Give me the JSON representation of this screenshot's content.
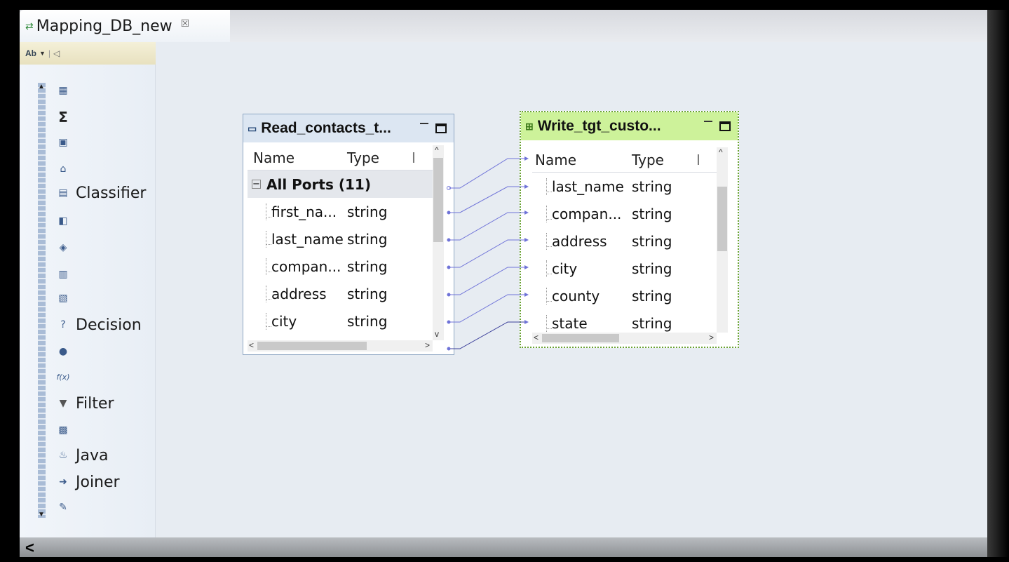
{
  "tab": {
    "title": "Mapping_DB_new",
    "close_glyph": "☒"
  },
  "palette": {
    "items": [
      {
        "icon": "expression-icon",
        "label": ""
      },
      {
        "icon": "aggregator-sigma-icon",
        "label": ""
      },
      {
        "icon": "case-converter-icon",
        "label": ""
      },
      {
        "icon": "address-validator-icon",
        "label": ""
      },
      {
        "icon": "classifier-icon",
        "label": "Classifier"
      },
      {
        "icon": "comparison-icon",
        "label": ""
      },
      {
        "icon": "consolidation-icon",
        "label": ""
      },
      {
        "icon": "data-masking-icon",
        "label": ""
      },
      {
        "icon": "data-processor-icon",
        "label": ""
      },
      {
        "icon": "decision-icon",
        "label": "Decision"
      },
      {
        "icon": "exception-icon",
        "label": ""
      },
      {
        "icon": "expression-fx-icon",
        "label": ""
      },
      {
        "icon": "filter-icon",
        "label": "Filter"
      },
      {
        "icon": "identity-match-icon",
        "label": ""
      },
      {
        "icon": "java-icon",
        "label": "Java"
      },
      {
        "icon": "joiner-icon",
        "label": "Joiner"
      },
      {
        "icon": "key-generator-icon",
        "label": ""
      }
    ],
    "fx_text": "f(x)"
  },
  "read_box": {
    "title": "Read_contacts_t...",
    "columns": {
      "name": "Name",
      "type": "Type"
    },
    "group": "All Ports (11)",
    "rows": [
      {
        "name": "first_na...",
        "type": "string"
      },
      {
        "name": "last_name",
        "type": "string"
      },
      {
        "name": "compan...",
        "type": "string"
      },
      {
        "name": "address",
        "type": "string"
      },
      {
        "name": "city",
        "type": "string"
      }
    ]
  },
  "write_box": {
    "title": "Write_tgt_custo...",
    "columns": {
      "name": "Name",
      "type": "Type"
    },
    "rows": [
      {
        "name": "last_name",
        "type": "string"
      },
      {
        "name": "compan...",
        "type": "string"
      },
      {
        "name": "address",
        "type": "string"
      },
      {
        "name": "city",
        "type": "string"
      },
      {
        "name": "county",
        "type": "string"
      },
      {
        "name": "state",
        "type": "string"
      }
    ]
  },
  "colors": {
    "canvas": "#e7ecf2",
    "write_header": "#cdf29a",
    "read_header": "#dce6f2",
    "link": "#6f73d8"
  }
}
